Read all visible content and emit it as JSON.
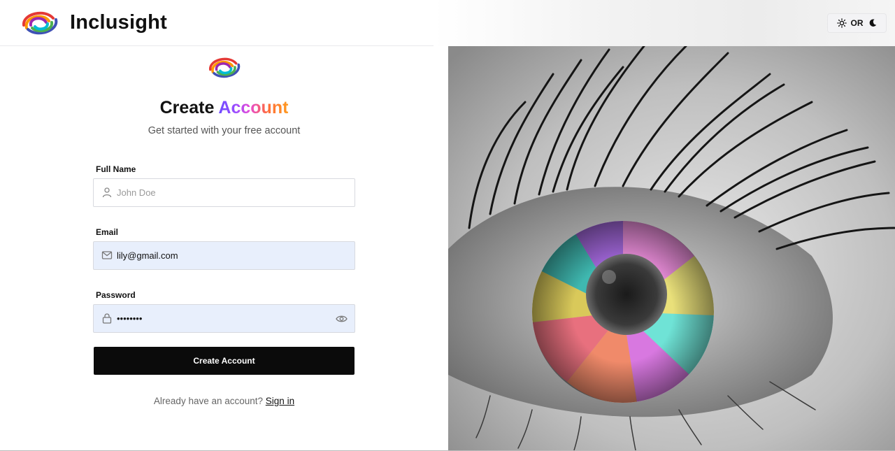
{
  "header": {
    "brand_name": "Inclusight",
    "theme_toggle": {
      "label": "OR",
      "light_icon": "sun-icon",
      "dark_icon": "moon-icon"
    }
  },
  "form": {
    "title_plain": "Create",
    "title_colored": "Account",
    "subtitle": "Get started with your free account",
    "full_name": {
      "label": "Full Name",
      "placeholder": "John Doe",
      "value": "",
      "icon": "user-icon"
    },
    "email": {
      "label": "Email",
      "value": "lily@gmail.com",
      "icon": "mail-icon"
    },
    "password": {
      "label": "Password",
      "value": "lilypass",
      "icon": "lock-icon",
      "toggle_icon": "eye-icon"
    },
    "submit_label": "Create Account",
    "signin_prompt": "Already have an account?",
    "signin_link": "Sign in"
  },
  "colors": {
    "button_bg": "#0b0b0b",
    "autofill_bg": "#e8effc",
    "accent_gradient": [
      "#6d4cff",
      "#e64ad6",
      "#ff9a1f"
    ]
  }
}
